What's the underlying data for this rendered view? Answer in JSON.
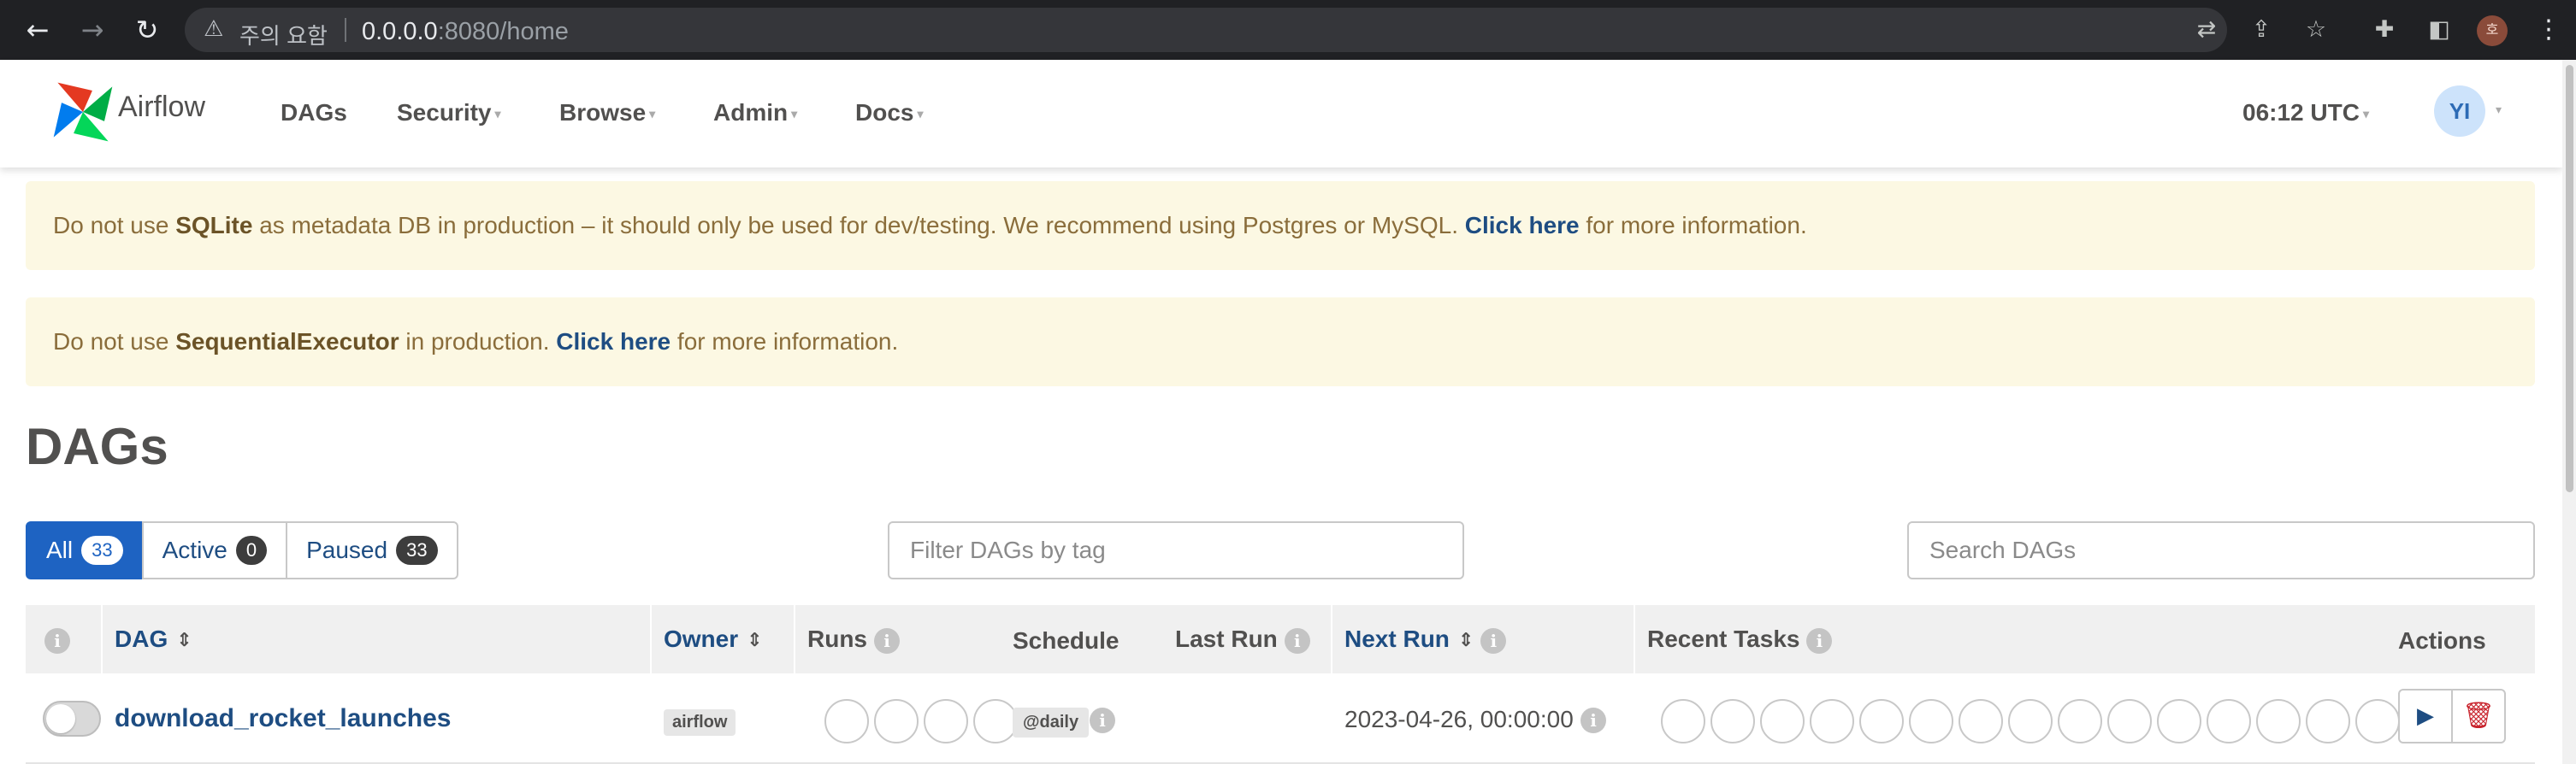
{
  "browser": {
    "warning_text": "주의 요함",
    "url_host": "0.0.0.0",
    "url_rest": ":8080/home"
  },
  "navbar": {
    "brand": "Airflow",
    "menu": [
      "DAGs",
      "Security",
      "Browse",
      "Admin",
      "Docs"
    ],
    "clock": "06:12 UTC",
    "user_initials": "YI"
  },
  "alerts": {
    "sqlite": {
      "pre": "Do not use ",
      "bold": "SQLite",
      "mid": " as metadata DB in production – it should only be used for dev/testing. We recommend using Postgres or MySQL. ",
      "link": "Click here",
      "post": " for more information."
    },
    "executor": {
      "pre": "Do not use ",
      "bold": "SequentialExecutor",
      "mid": " in production. ",
      "link": "Click here",
      "post": " for more information."
    }
  },
  "page_title": "DAGs",
  "filters": {
    "all": {
      "label": "All",
      "count": "33"
    },
    "active": {
      "label": "Active",
      "count": "0"
    },
    "paused": {
      "label": "Paused",
      "count": "33"
    },
    "tag_placeholder": "Filter DAGs by tag",
    "search_placeholder": "Search DAGs"
  },
  "table": {
    "headers": {
      "dag": "DAG",
      "owner": "Owner",
      "runs": "Runs",
      "schedule": "Schedule",
      "last_run": "Last Run",
      "next_run": "Next Run",
      "recent_tasks": "Recent Tasks",
      "actions": "Actions"
    },
    "rows": [
      {
        "dag_id": "download_rocket_launches",
        "paused": true,
        "owner": "airflow",
        "schedule": "@daily",
        "last_run": "",
        "next_run": "2023-04-26, 00:00:00",
        "run_circles": 4,
        "task_circles": 15
      }
    ]
  },
  "colors": {
    "primary": "#1e63c2",
    "link": "#1e4d82",
    "alert_bg": "#fcf8e3",
    "danger": "#c8232c"
  }
}
